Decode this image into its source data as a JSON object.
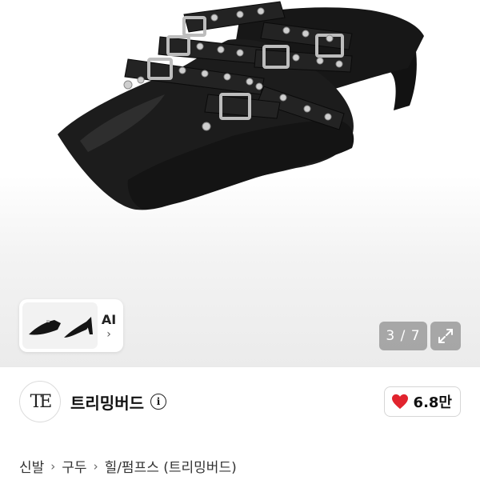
{
  "gallery": {
    "current_page": "3",
    "total_pages": "7",
    "counter_text": "3 / 7",
    "expand_icon": "expand-arrows-icon"
  },
  "ai_card": {
    "label": "AI",
    "chevron": "›"
  },
  "store": {
    "logo_text": "TE",
    "name": "트리밍버드",
    "info_icon": "i",
    "favorite_count": "6.8만",
    "favorite_icon_color": "#e1242e"
  },
  "breadcrumb": {
    "items": [
      "신발",
      "구두",
      "힐/펌프스 (트리밍버드)"
    ],
    "separator": "›"
  }
}
